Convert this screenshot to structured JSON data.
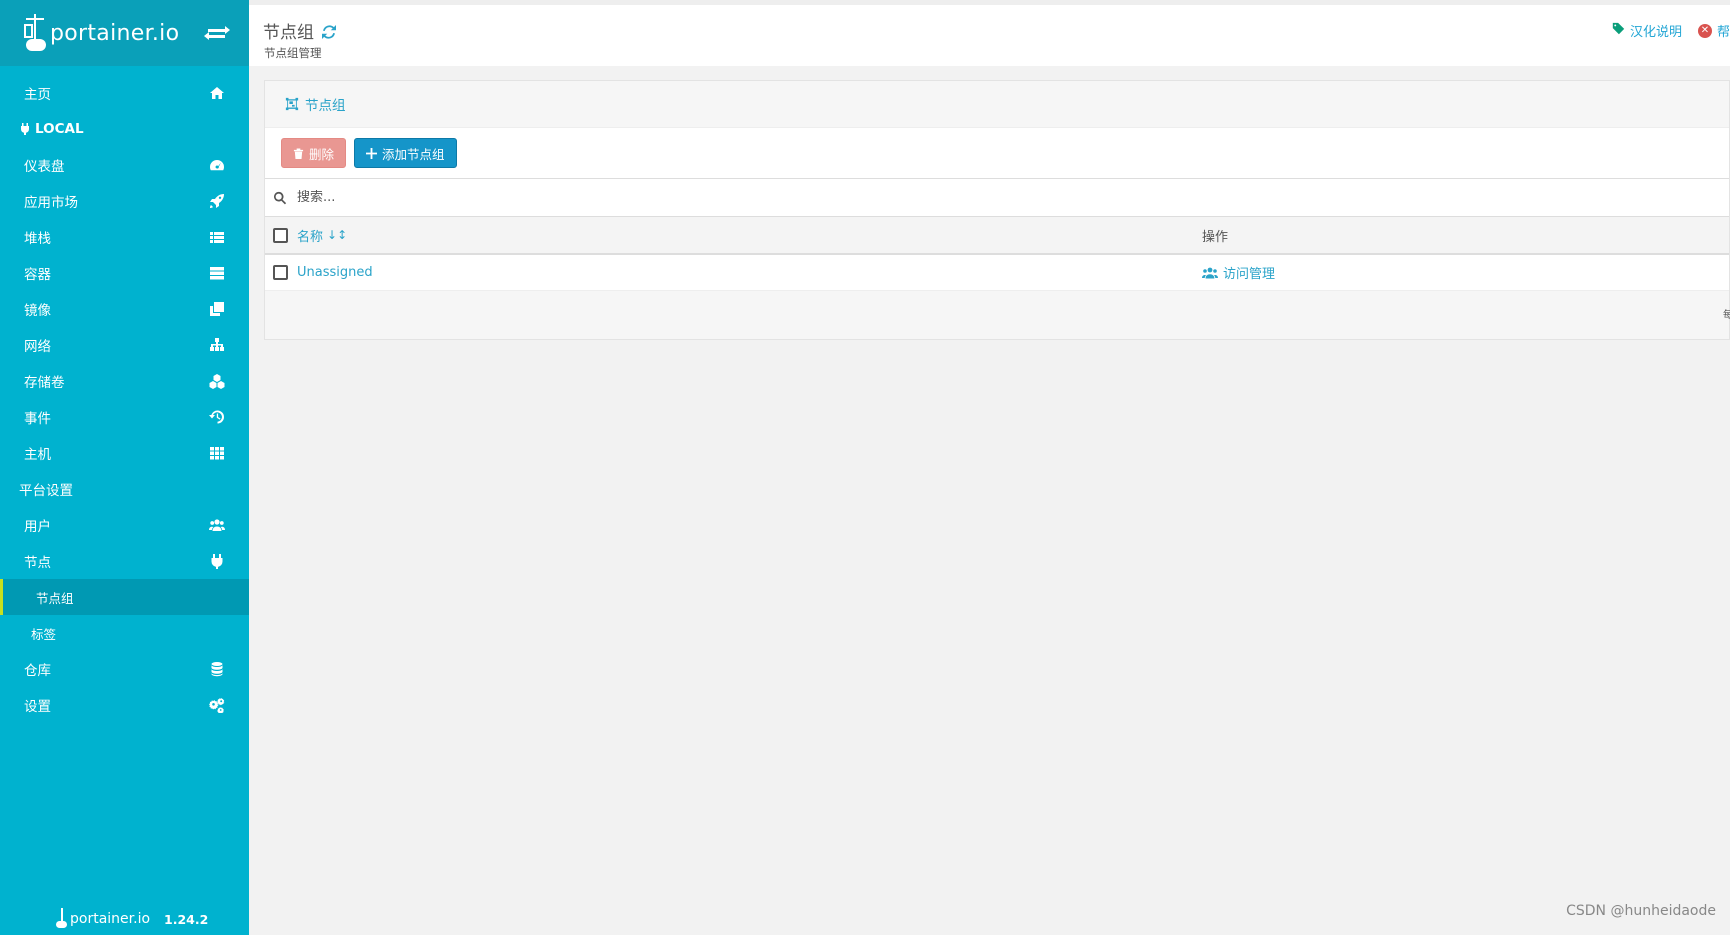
{
  "brand": {
    "name": "portainer.io",
    "version": "1.24.2"
  },
  "sidebar": {
    "items": [
      {
        "label": "主页",
        "icon": "home-icon",
        "kind": "item"
      },
      {
        "label": "LOCAL",
        "icon": "plug-icon",
        "kind": "title"
      },
      {
        "label": "仪表盘",
        "icon": "dashboard-icon",
        "kind": "item"
      },
      {
        "label": "应用市场",
        "icon": "rocket-icon",
        "kind": "item"
      },
      {
        "label": "堆栈",
        "icon": "list-icon",
        "kind": "item"
      },
      {
        "label": "容器",
        "icon": "server-icon",
        "kind": "item"
      },
      {
        "label": "镜像",
        "icon": "clone-icon",
        "kind": "item"
      },
      {
        "label": "网络",
        "icon": "sitemap-icon",
        "kind": "item"
      },
      {
        "label": "存储卷",
        "icon": "cubes-icon",
        "kind": "item"
      },
      {
        "label": "事件",
        "icon": "history-icon",
        "kind": "item"
      },
      {
        "label": "主机",
        "icon": "grid-icon",
        "kind": "item"
      },
      {
        "label": "平台设置",
        "icon": "",
        "kind": "title"
      },
      {
        "label": "用户",
        "icon": "users-icon",
        "kind": "item"
      },
      {
        "label": "节点",
        "icon": "plug-icon",
        "kind": "item"
      },
      {
        "label": "节点组",
        "icon": "",
        "kind": "sub-active"
      },
      {
        "label": "标签",
        "icon": "",
        "kind": "sub"
      },
      {
        "label": "仓库",
        "icon": "database-icon",
        "kind": "item"
      },
      {
        "label": "设置",
        "icon": "cogs-icon",
        "kind": "item"
      }
    ]
  },
  "header": {
    "title": "节点组",
    "breadcrumb": "节点组管理",
    "links": [
      {
        "label": "汉化说明",
        "icon": "tag-icon"
      },
      {
        "label": "帮",
        "icon": "close-circle-icon"
      }
    ]
  },
  "widget": {
    "title": "节点组",
    "delete_label": "删除",
    "add_label": "添加节点组",
    "search_placeholder": "搜索...",
    "columns": {
      "name": "名称",
      "ops": "操作"
    },
    "rows": [
      {
        "name": "Unassigned",
        "action": "访问管理"
      }
    ],
    "footer_fragment": "每"
  },
  "colors": {
    "sidebar": "#00b2cf",
    "sidebar_header": "#0aa0b9",
    "accent": "#2aa3c9",
    "primary_button": "#1595c9",
    "danger_button": "#e99792"
  },
  "watermark": "CSDN @hunheidaode"
}
